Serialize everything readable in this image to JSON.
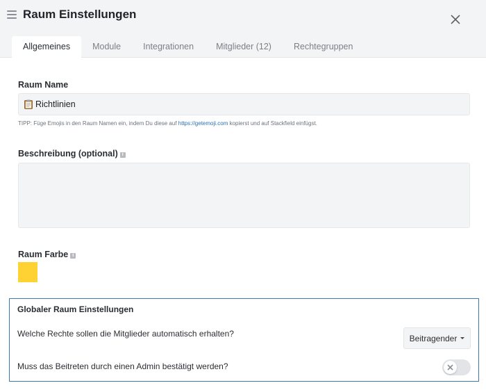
{
  "header": {
    "title": "Raum Einstellungen"
  },
  "tabs": [
    {
      "label": "Allgemeines",
      "active": true
    },
    {
      "label": "Module",
      "active": false
    },
    {
      "label": "Integrationen",
      "active": false
    },
    {
      "label": "Mitglieder (12)",
      "active": false
    },
    {
      "label": "Rechtegruppen",
      "active": false
    }
  ],
  "form": {
    "name_label": "Raum Name",
    "name_value": "Richtlinien",
    "tip_before": "TIPP: Füge Emojis in den Raum Namen ein, indem Du diese auf ",
    "tip_link": "https://getemoji.com",
    "tip_after": " kopierst und auf Stackfield einfügst.",
    "description_label": "Beschreibung (optional)",
    "description_value": "",
    "color_label": "Raum Farbe",
    "color_value": "#ffd233"
  },
  "global": {
    "title": "Globaler Raum Einstellungen",
    "rights_question": "Welche Rechte sollen die Mitglieder automatisch erhalten?",
    "rights_selected": "Beitragender",
    "admin_question": "Muss das Beitreten durch einen Admin bestätigt werden?",
    "admin_confirm": false
  },
  "icons": {
    "menu": "hamburger-menu-icon",
    "close": "close-icon",
    "info": "info-icon",
    "clipboard": "clipboard-emoji-icon",
    "caret": "caret-down-icon",
    "toggle_off": "toggle-x-icon"
  }
}
